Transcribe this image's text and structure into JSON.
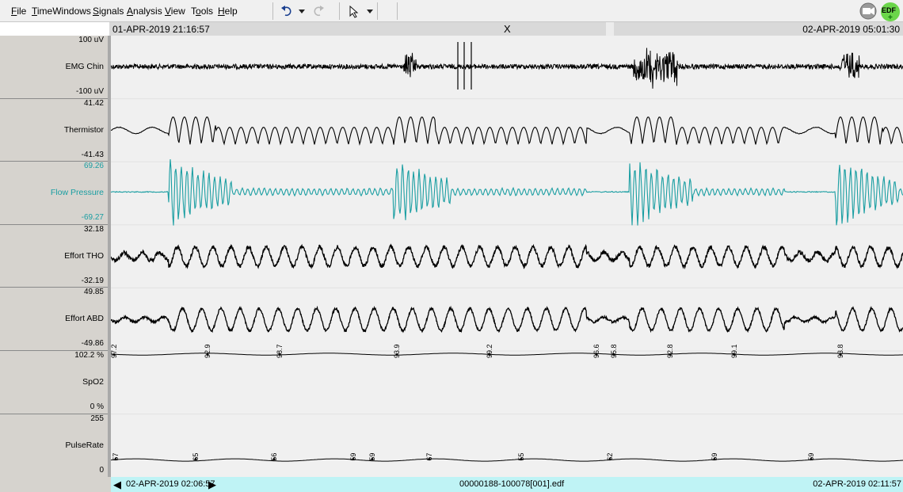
{
  "menu": {
    "file": {
      "u": "F",
      "rest": "ile"
    },
    "timewindows": {
      "u": "T",
      "rest": "imeWindows"
    },
    "signals": {
      "u": "S",
      "rest": "ignals"
    },
    "analysis": {
      "u": "A",
      "rest": "nalysis"
    },
    "view": {
      "u": "V",
      "rest": "iew"
    },
    "tools": {
      "pre": "T",
      "u": "o",
      "rest": "ols"
    },
    "help": {
      "u": "H",
      "rest": "elp"
    }
  },
  "toolbar": {
    "icons": [
      "undo-icon",
      "dropdown-arrow-icon",
      "redo-icon",
      "pointer-icon",
      "dropdown-arrow-icon"
    ],
    "edf_badge": "EDF"
  },
  "timebar": {
    "start": "01-APR-2019 21:16:57",
    "close": "X",
    "end": "02-APR-2019 05:01:30"
  },
  "signals": [
    {
      "name": "EMG Chin",
      "max": "100 uV",
      "min": "-100 uV",
      "color": "#000000"
    },
    {
      "name": "Thermistor",
      "max": "41.42",
      "min": "-41.43",
      "color": "#000000"
    },
    {
      "name": "Flow Pressure",
      "max": "69.26",
      "min": "-69.27",
      "color": "#1a9ea2"
    },
    {
      "name": "Effort THO",
      "max": "32.18",
      "min": "-32.19",
      "color": "#000000"
    },
    {
      "name": "Effort ABD",
      "max": "49.85",
      "min": "-49.86",
      "color": "#000000"
    },
    {
      "name": "SpO2",
      "max": "102.2 %",
      "min": "0 %",
      "color": "#000000"
    },
    {
      "name": "PulseRate",
      "max": "255",
      "min": "0",
      "color": "#000000"
    }
  ],
  "spo2_points": [
    "97.2",
    "92.9",
    "98.7",
    "93.9",
    "99.2",
    "96.6",
    "95.8",
    "92.8",
    "99.1",
    "93.8"
  ],
  "pulse_points": [
    "57",
    "65",
    "56",
    "59",
    "59",
    "67",
    "55",
    "62",
    "59",
    "59"
  ],
  "footer": {
    "left_time": "02-APR-2019 02:06:57",
    "filename": "00000188-100078[001].edf",
    "right_time": "02-APR-2019 02:11:57"
  }
}
